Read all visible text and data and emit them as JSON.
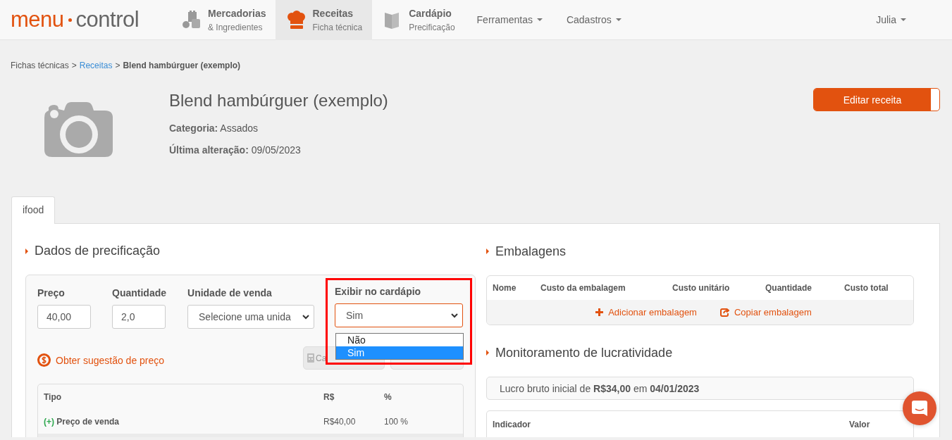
{
  "nav": {
    "logo": {
      "left": "menu",
      "right": "control"
    },
    "items": [
      {
        "kind": "module",
        "title": "Mercadorias",
        "subtitle": "& Ingredientes",
        "selected": false
      },
      {
        "kind": "module",
        "title": "Receitas",
        "subtitle": "Ficha técnica",
        "selected": true
      },
      {
        "kind": "module",
        "title": "Cardápio",
        "subtitle": "Precificação",
        "selected": false
      },
      {
        "kind": "menu",
        "title": "Ferramentas"
      },
      {
        "kind": "menu",
        "title": "Cadastros"
      }
    ],
    "user": "Julia"
  },
  "breadcrumb": [
    {
      "kind": "text",
      "text": "Fichas técnicas"
    },
    {
      "kind": "sep",
      "text": ">"
    },
    {
      "kind": "link",
      "text": "Receitas"
    },
    {
      "kind": "sep",
      "text": ">"
    },
    {
      "kind": "current",
      "text": "Blend hambúrguer (exemplo)"
    }
  ],
  "recipe": {
    "title": "Blend hambúrguer (exemplo)",
    "fields": [
      {
        "label": "Categoria:",
        "value": "Assados"
      },
      {
        "label": "Última alteração:",
        "value": "09/05/2023"
      }
    ],
    "edit_button": "Editar receita"
  },
  "tabs": [
    {
      "label": "ifood",
      "selected": true
    }
  ],
  "pricing": {
    "title": "Dados de precificação",
    "fields": [
      {
        "kind": "input",
        "label": "Preço",
        "value": "40,00"
      },
      {
        "kind": "input",
        "label": "Quantidade",
        "value": "2,0"
      },
      {
        "kind": "select",
        "label": "Unidade de venda",
        "value": "Selecione uma unida",
        "open": false,
        "highlighted": false
      },
      {
        "kind": "select",
        "label": "Exibir no cardápio",
        "value": "Sim",
        "open": true,
        "highlighted": true,
        "options": [
          {
            "label": "Não",
            "selected": false
          },
          {
            "label": "Sim",
            "selected": true
          }
        ]
      }
    ],
    "suggestion_link": "Obter sugestão de preço",
    "buttons": [
      {
        "kind": "calculator",
        "label": "Ca"
      },
      {
        "kind": "blank"
      }
    ],
    "table": {
      "columns": [
        "Tipo",
        "R$",
        "%"
      ],
      "rows": [
        {
          "sign": "(+)",
          "name": "Preço de venda",
          "value": "R$40,00",
          "percent": "100 %"
        }
      ]
    }
  },
  "packaging": {
    "title": "Embalagens",
    "columns": [
      "Nome",
      "Custo da embalagem",
      "Custo unitário",
      "Quantidade",
      "Custo total"
    ],
    "actions": [
      {
        "kind": "add",
        "label": "Adicionar embalagem"
      },
      {
        "kind": "copy",
        "label": "Copiar embalagem"
      }
    ]
  },
  "profit": {
    "title": "Monitoramento de lucratividade",
    "summary": "Lucro bruto inicial de **R$34,00** em **04/01/2023**",
    "columns": [
      "Indicador",
      "Valor"
    ]
  }
}
